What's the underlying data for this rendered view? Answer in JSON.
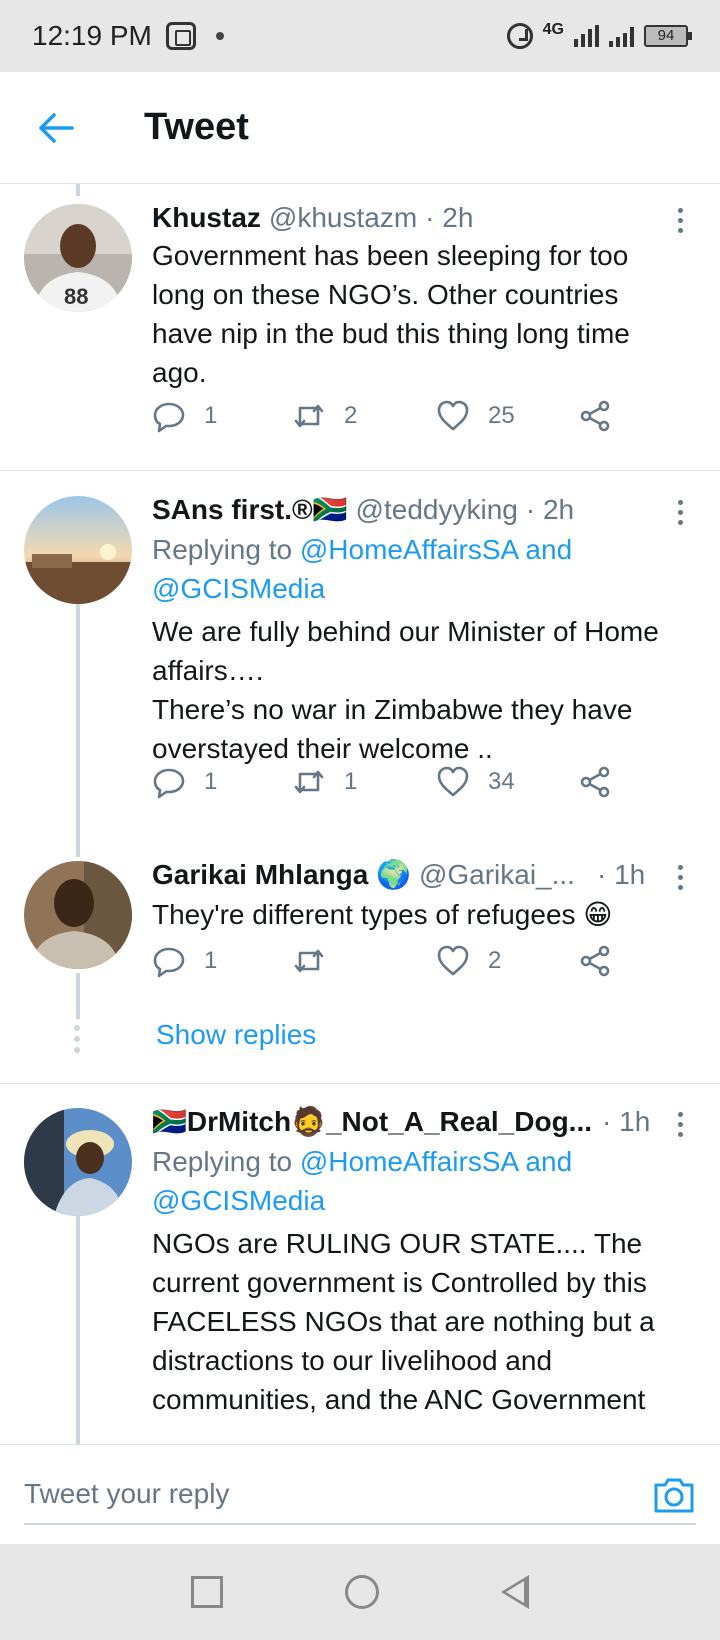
{
  "status_bar": {
    "time": "12:19 PM",
    "network": "4G",
    "battery": "94"
  },
  "header": {
    "title": "Tweet"
  },
  "tweets": [
    {
      "name": "Khustaz",
      "handle": "@khustazm",
      "time": "· 2h",
      "text": "Government has been sleeping for too long on these NGO’s. Other countries have nip in the bud this thing long time ago.",
      "replies": "1",
      "retweets": "2",
      "likes": "25"
    },
    {
      "name": "SAns first.®",
      "flag": "🇿🇦",
      "handle": "@teddyyking",
      "time": "· 2h",
      "replying_prefix": "Replying to ",
      "mention1": "@HomeAffairsSA",
      "and": " and ",
      "mention2": "@GCISMedia",
      "text": "We are fully behind our Minister of Home affairs….\nThere’s no war in Zimbabwe they have overstayed their welcome ..",
      "replies": "1",
      "retweets": "1",
      "likes": "34"
    },
    {
      "name": "Garikai Mhlanga 🌍",
      "handle": "@Garikai_...",
      "time": "· 1h",
      "text": "They're different types of refugees 😁",
      "replies": "1",
      "retweets": "",
      "likes": "2"
    },
    {
      "name": "🇿🇦DrMitch🧔_Not_A_Real_Dog...",
      "handle": "",
      "time": "· 1h",
      "replying_prefix": "Replying to ",
      "mention1": "@HomeAffairsSA",
      "and": " and ",
      "mention2": "@GCISMedia",
      "text": "NGOs are RULING OUR STATE.... The current government is Controlled by this FACELESS NGOs that are nothing but a distractions to our livelihood and communities, and the ANC Government"
    }
  ],
  "show_replies": "Show replies",
  "reply_bar": {
    "placeholder": "Tweet your reply"
  },
  "colors": {
    "accent": "#1d9bf0",
    "text": "#14171a",
    "muted": "#657786",
    "divider": "#e1e8ed"
  },
  "icons": [
    "back-arrow-icon",
    "more-icon",
    "reply-icon",
    "retweet-icon",
    "like-icon",
    "share-icon",
    "camera-icon"
  ]
}
